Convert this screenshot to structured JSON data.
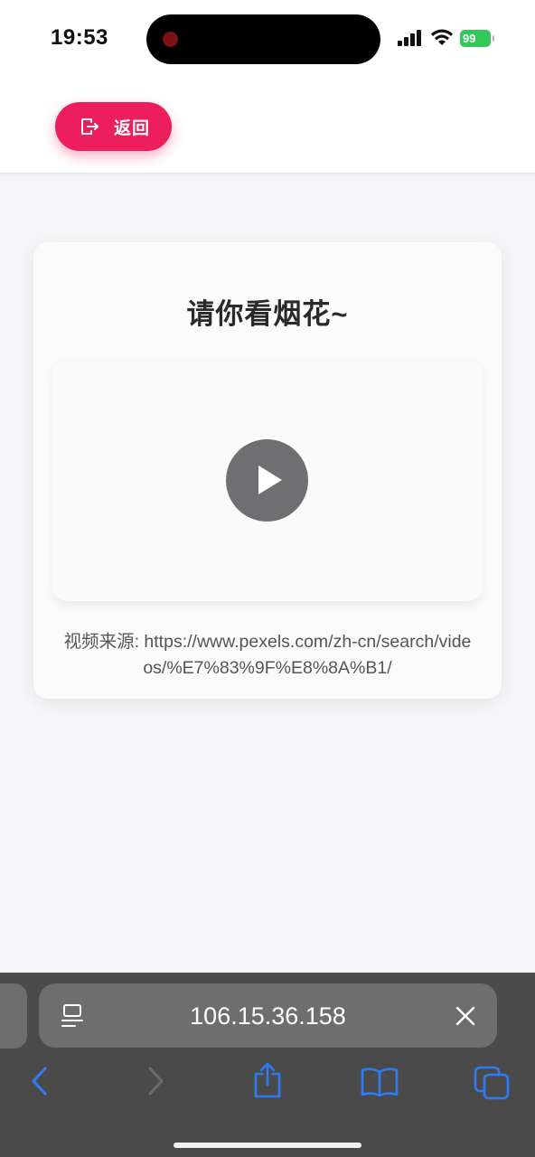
{
  "status": {
    "time": "19:53",
    "battery": "99"
  },
  "header": {
    "back_label": "返回",
    "back_icon": "logout-arrow-icon",
    "accent": "#ec1f5c"
  },
  "card": {
    "title": "请你看烟花~",
    "video": {
      "play_icon": "play-icon"
    },
    "source_text": "视频来源: https://www.pexels.com/zh-cn/search/videos/%E7%83%9F%E8%8A%B1/"
  },
  "browser": {
    "address": "106.15.36.158",
    "icons": [
      "reader-icon",
      "clear-icon",
      "back-chevron-icon",
      "forward-chevron-icon",
      "share-icon",
      "bookmarks-icon",
      "tabs-icon"
    ],
    "accent": "#2f7bf5"
  }
}
